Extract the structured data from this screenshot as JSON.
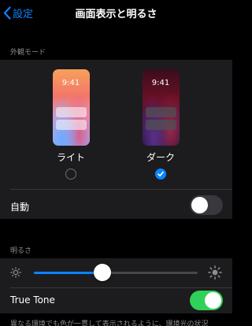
{
  "nav": {
    "back_label": "設定",
    "title": "画面表示と明るさ"
  },
  "appearance": {
    "header": "外観モード",
    "light": {
      "label": "ライト",
      "time": "9:41",
      "selected": false
    },
    "dark": {
      "label": "ダーク",
      "time": "9:41",
      "selected": true
    },
    "auto_label": "自動",
    "auto_enabled": false
  },
  "brightness": {
    "header": "明るさ",
    "level": 0.42,
    "true_tone_label": "True Tone",
    "true_tone_enabled": true
  },
  "footer": {
    "note": "異なる環境でも色が一貫して表示されるように、環境光の状況"
  },
  "colors": {
    "accent": "#0a84ff",
    "toggle_on": "#30d158",
    "background": "#000000",
    "group_background": "#1c1c1e"
  }
}
